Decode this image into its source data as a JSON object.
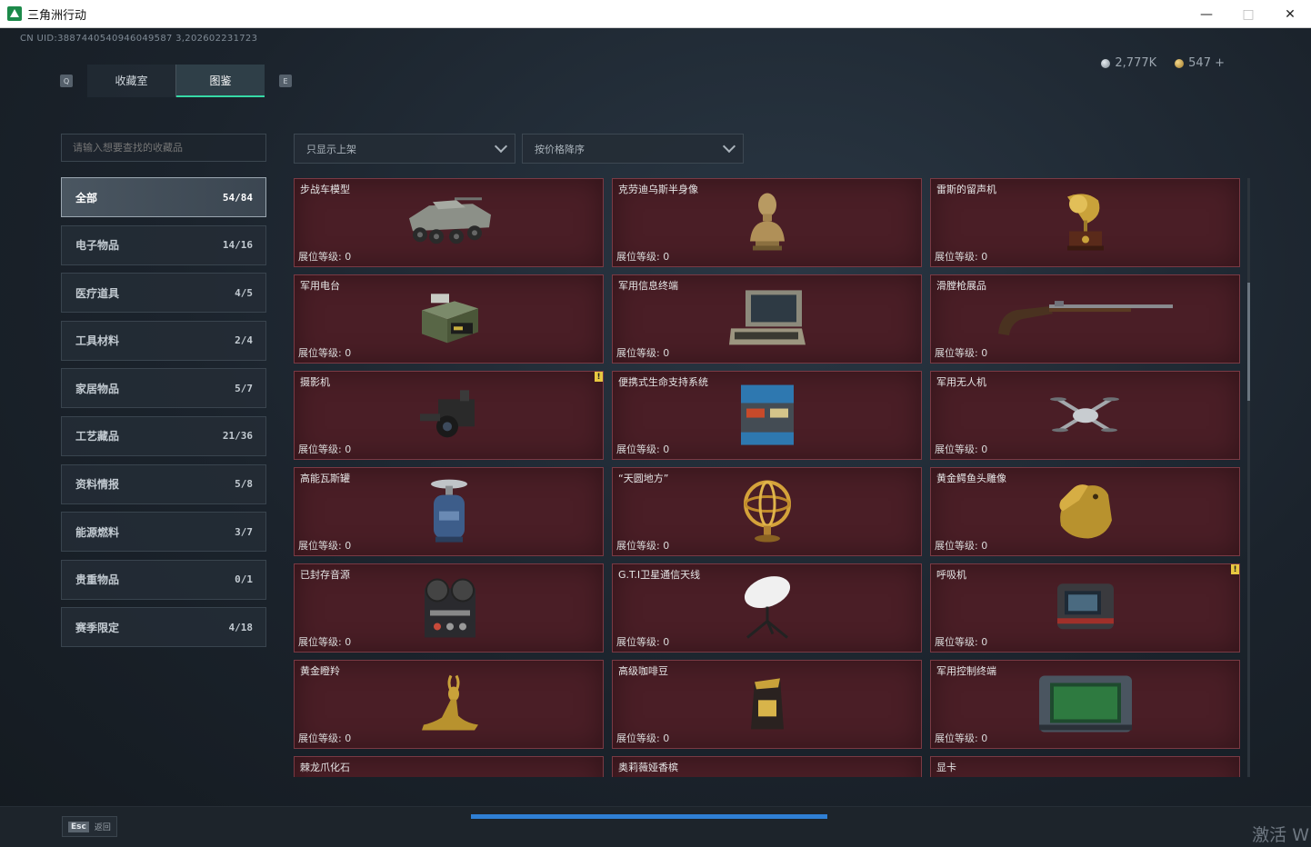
{
  "window": {
    "title": "三角洲行动",
    "controls": {
      "minimize": "—",
      "maximize": "□",
      "close": "✕"
    }
  },
  "header": {
    "uid": "CN UID:3887440540946049587 3,202602231723",
    "currency": [
      {
        "icon": "silver-coin-icon",
        "value": "2,777K"
      },
      {
        "icon": "gold-coin-icon",
        "value": "547 +"
      }
    ]
  },
  "tabs": {
    "left_key": "Q",
    "right_key": "E",
    "items": [
      {
        "label": "收藏室",
        "active": false
      },
      {
        "label": "图鉴",
        "active": true
      }
    ]
  },
  "search": {
    "placeholder": "请输入想要查找的收藏品"
  },
  "categories": [
    {
      "label": "全部",
      "count": "54/84",
      "active": true
    },
    {
      "label": "电子物品",
      "count": "14/16"
    },
    {
      "label": "医疗道具",
      "count": "4/5"
    },
    {
      "label": "工具材料",
      "count": "2/4"
    },
    {
      "label": "家居物品",
      "count": "5/7"
    },
    {
      "label": "工艺藏品",
      "count": "21/36"
    },
    {
      "label": "资料情报",
      "count": "5/8"
    },
    {
      "label": "能源燃料",
      "count": "3/7"
    },
    {
      "label": "贵重物品",
      "count": "0/1"
    },
    {
      "label": "赛季限定",
      "count": "4/18"
    }
  ],
  "filters": {
    "shelf": "只显示上架",
    "sort": "按价格降序"
  },
  "level_label": "展位等级: 0",
  "items": [
    {
      "name": "步战车模型",
      "icon": "ifv-model-icon"
    },
    {
      "name": "克劳迪乌斯半身像",
      "icon": "bust-icon"
    },
    {
      "name": "雷斯的留声机",
      "icon": "gramophone-icon"
    },
    {
      "name": "军用电台",
      "icon": "radio-icon"
    },
    {
      "name": "军用信息终端",
      "icon": "terminal-icon"
    },
    {
      "name": "滑膛枪展品",
      "icon": "musket-icon"
    },
    {
      "name": "摄影机",
      "icon": "camera-icon",
      "alert": "!"
    },
    {
      "name": "便携式生命支持系统",
      "icon": "life-support-icon"
    },
    {
      "name": "军用无人机",
      "icon": "drone-icon"
    },
    {
      "name": "高能瓦斯罐",
      "icon": "gas-tank-icon"
    },
    {
      "name": "“天圆地方”",
      "icon": "armillary-icon"
    },
    {
      "name": "黄金鳄鱼头雕像",
      "icon": "croc-head-icon"
    },
    {
      "name": "已封存音源",
      "icon": "reel-recorder-icon"
    },
    {
      "name": "G.T.I卫星通信天线",
      "icon": "satellite-dish-icon"
    },
    {
      "name": "呼吸机",
      "icon": "ventilator-icon",
      "alert": "!"
    },
    {
      "name": "黄金瞪羚",
      "icon": "gazelle-icon"
    },
    {
      "name": "高级咖啡豆",
      "icon": "coffee-bag-icon"
    },
    {
      "name": "军用控制终端",
      "icon": "control-terminal-icon"
    },
    {
      "name": "棘龙爪化石",
      "icon": "fossil-icon"
    },
    {
      "name": "奥莉薇娅香槟",
      "icon": "champagne-icon"
    },
    {
      "name": "显卡",
      "icon": "gpu-icon"
    }
  ],
  "footer": {
    "esc_key": "Esc",
    "esc_label": "返回",
    "watermark": "激活 W"
  },
  "colors": {
    "accent": "#36d9a6",
    "card_bg": "#4a1e26",
    "card_border": "#7a3a44",
    "alert": "#e8c840"
  }
}
